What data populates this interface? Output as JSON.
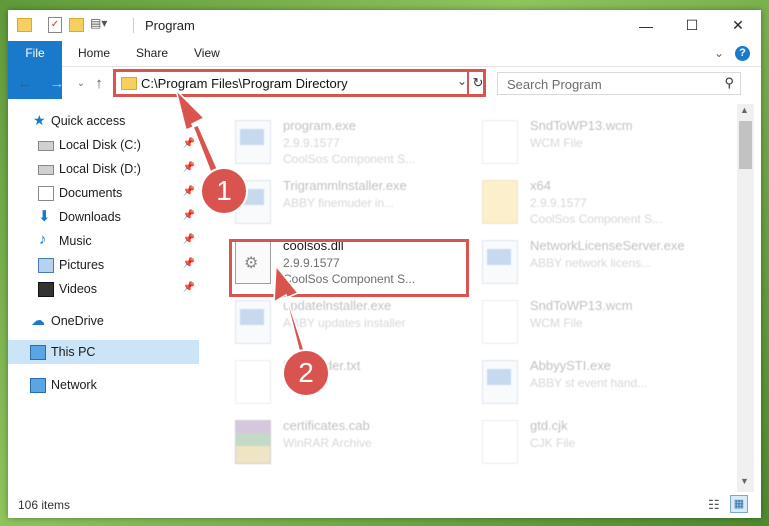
{
  "window": {
    "title": "Program",
    "minimize_glyph": "—",
    "maximize_glyph": "☐",
    "close_glyph": "✕"
  },
  "ribbon": {
    "tabs": [
      "File",
      "Home",
      "Share",
      "View"
    ],
    "help_glyph": "?",
    "expand_glyph": "⌄"
  },
  "address": {
    "path": "C:\\Program Files\\Program Directory",
    "search_placeholder": "Search Program"
  },
  "sidebar": [
    {
      "label": "Quick access",
      "icon": "star-icon"
    },
    {
      "label": "Local Disk (C:)",
      "icon": "drive-icon",
      "pinned": true
    },
    {
      "label": "Local Disk (D:)",
      "icon": "drive-icon",
      "pinned": true
    },
    {
      "label": "Documents",
      "icon": "documents-icon",
      "pinned": true
    },
    {
      "label": "Downloads",
      "icon": "download-icon",
      "pinned": true
    },
    {
      "label": "Music",
      "icon": "music-icon",
      "pinned": true
    },
    {
      "label": "Pictures",
      "icon": "pictures-icon",
      "pinned": true
    },
    {
      "label": "Videos",
      "icon": "videos-icon",
      "pinned": true
    },
    {
      "label": "OneDrive",
      "icon": "cloud-icon"
    },
    {
      "label": "This PC",
      "icon": "computer-icon",
      "selected": true
    },
    {
      "label": "Network",
      "icon": "network-icon"
    }
  ],
  "files": [
    {
      "name": "program.exe",
      "version": "2.9.9.1577",
      "desc": "CoolSos Component S...",
      "kind": "exe"
    },
    {
      "name": "SndToWP13.wcm",
      "version": "WCM File",
      "desc": "",
      "kind": "doc"
    },
    {
      "name": "Trigrammlnstaller.exe",
      "version": "ABBY finemuder in...",
      "desc": "",
      "kind": "exe"
    },
    {
      "name": "x64",
      "version": "2.9.9.1577",
      "desc": "CoolSos Component S...",
      "kind": "folder"
    },
    {
      "name": "coolsos.dll",
      "version": "2.9.9.1577",
      "desc": "CoolSos Component S...",
      "kind": "dll"
    },
    {
      "name": "NetworkLicenseServer.exe",
      "version": "ABBY network licens...",
      "desc": "",
      "kind": "exe"
    },
    {
      "name": "updatelnstaller.exe",
      "version": "ABBY updates installer",
      "desc": "",
      "kind": "exe"
    },
    {
      "name": "SndToWP13.wcm",
      "version": "WCM File",
      "desc": "",
      "kind": "doc"
    },
    {
      "name": "h...Reader.txt",
      "version": "T...",
      "desc": "",
      "kind": "doc"
    },
    {
      "name": "AbbyySTI.exe",
      "version": "ABBY st event hand...",
      "desc": "",
      "kind": "exe"
    },
    {
      "name": "certificates.cab",
      "version": "WinRAR Archive",
      "desc": "",
      "kind": "cab"
    },
    {
      "name": "gtd.cjk",
      "version": "CJK File",
      "desc": "",
      "kind": "doc"
    }
  ],
  "status": {
    "item_count": "106 items"
  },
  "annotations": [
    {
      "number": "1"
    },
    {
      "number": "2"
    }
  ],
  "colors": {
    "accent": "#1979ca",
    "highlight": "#d9534f",
    "selected": "#cce4f7"
  }
}
